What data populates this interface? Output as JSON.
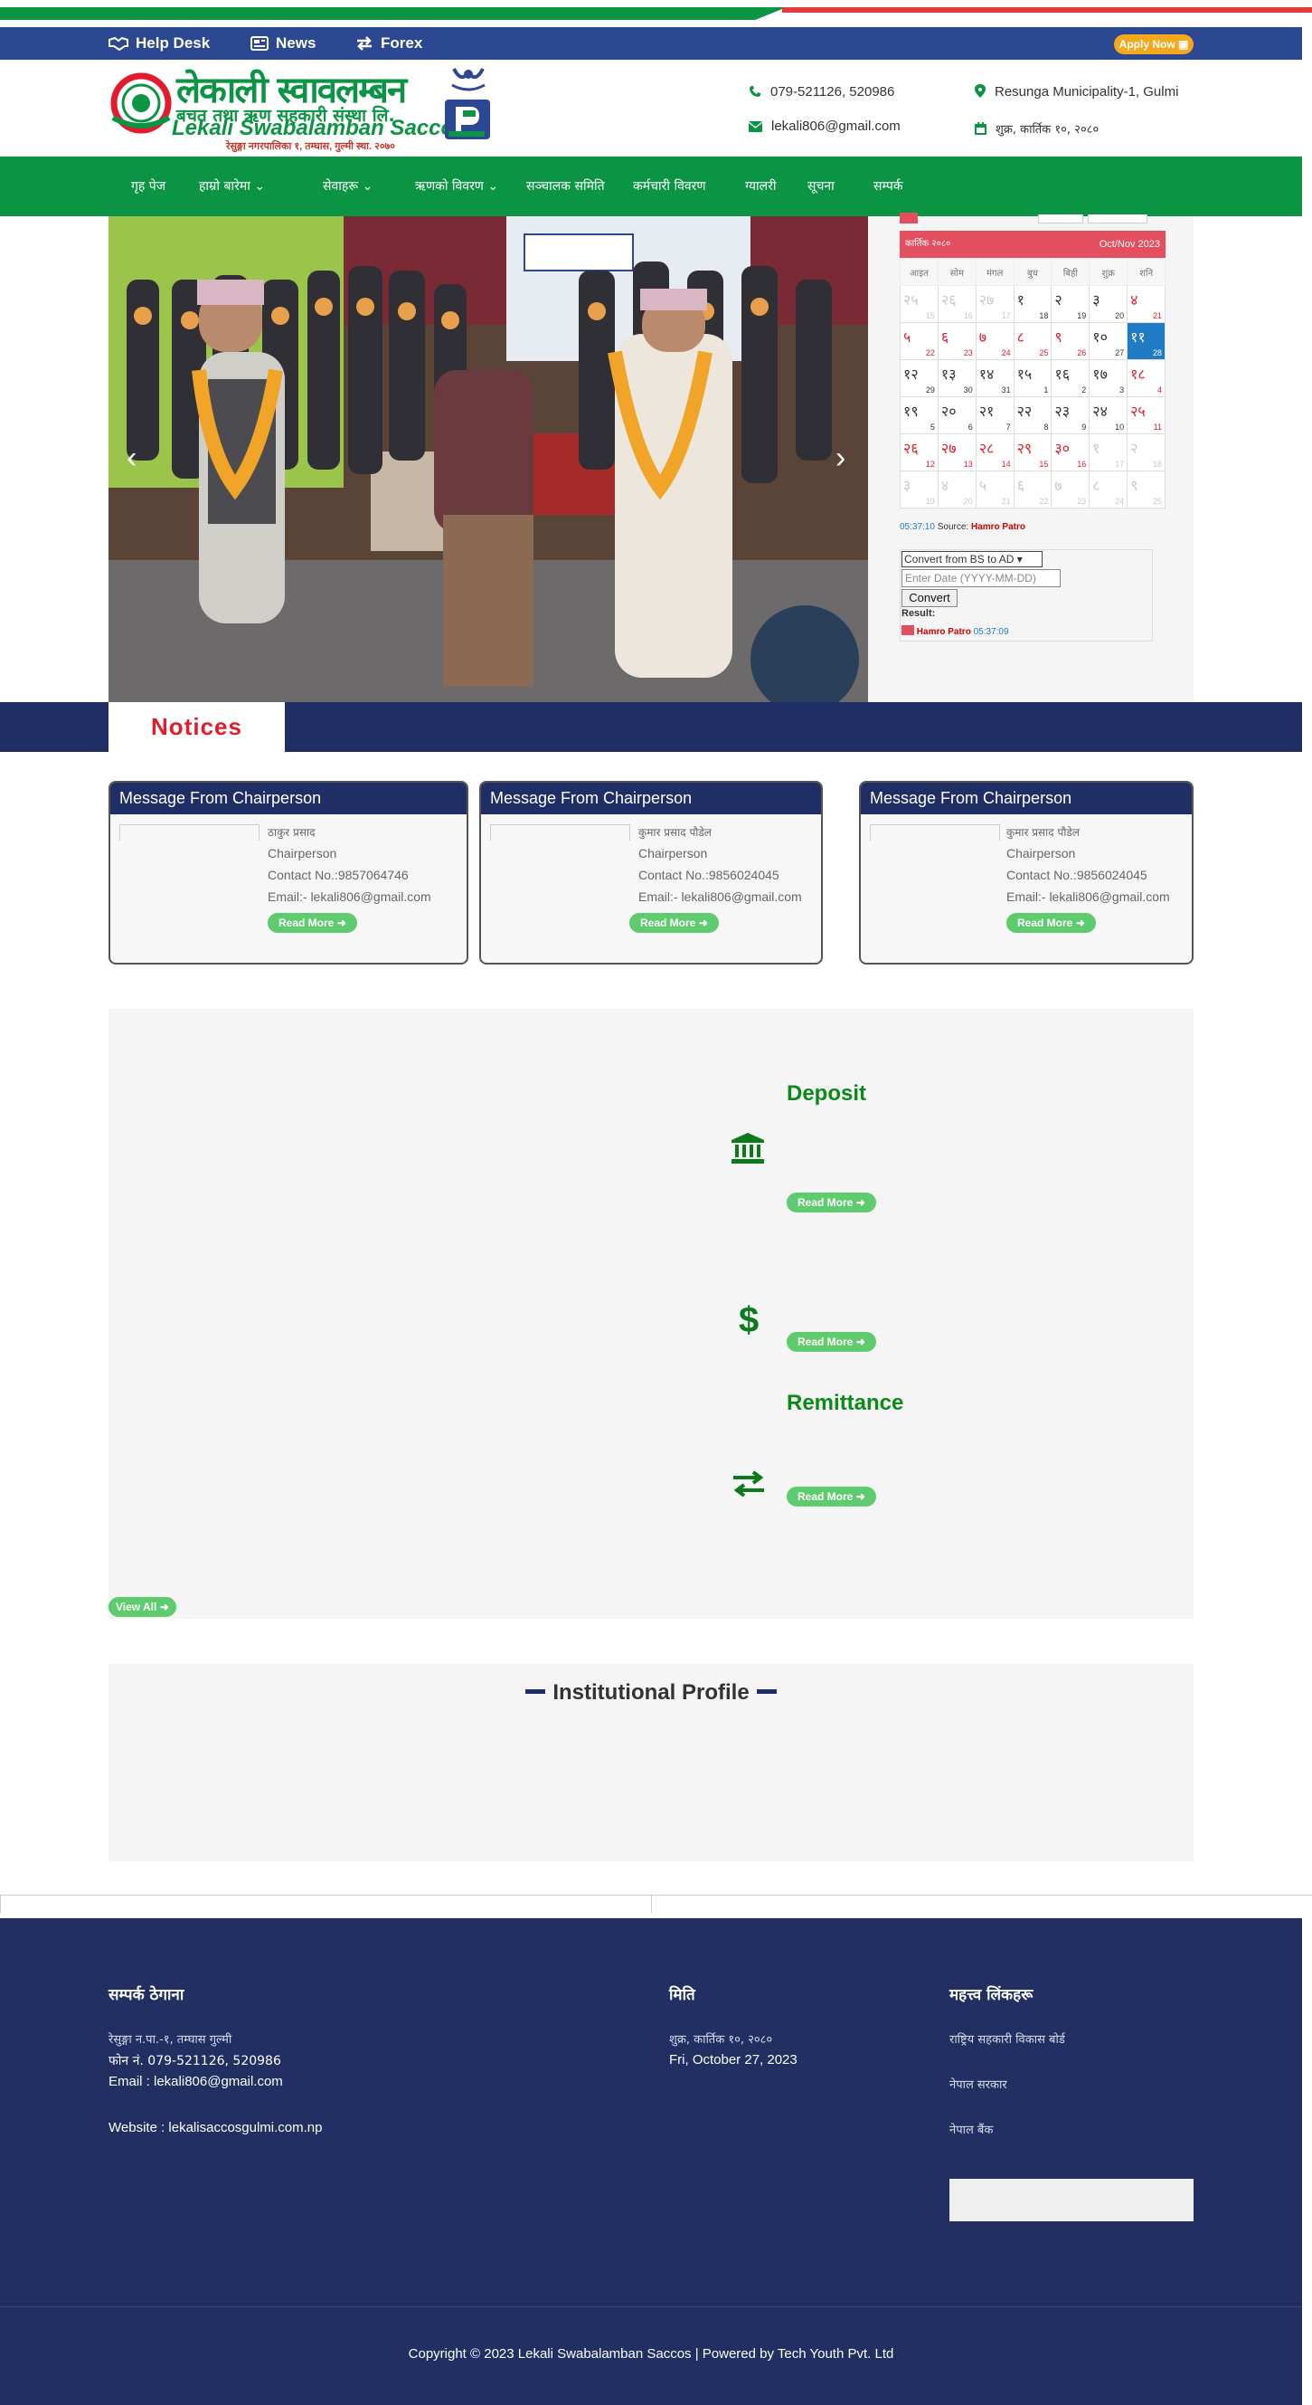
{
  "topbar": {
    "help_desk": "Help Desk",
    "news": "News",
    "forex": "Forex",
    "apply_now": "Apply Now"
  },
  "logo": {
    "nepali_name": "लेकाली स्वावलम्बन",
    "nepali_sub": "बचत तथा ऋण सहकारी संस्था लि.",
    "english_name": "Lekali Swabalamban Saccos",
    "address_line": "रेसुङ्गा नगरपालिका १, तम्घास, गुल्मी",
    "estd": "स्था. २०७०"
  },
  "header": {
    "phone": "079-521126, 520986",
    "email": "lekali806@gmail.com",
    "address": "Resunga Municipality-1, Gulmi",
    "date_np": "शुक्र, कार्तिक १०, २०८०"
  },
  "nav": {
    "items": [
      {
        "label": "गृह पेज",
        "dropdown": false
      },
      {
        "label": "हाम्रो बारेमा",
        "dropdown": true
      },
      {
        "label": "सेवाहरू",
        "dropdown": true
      },
      {
        "label": "ऋणको विवरण",
        "dropdown": true
      },
      {
        "label": "सञ्चालक समिति",
        "dropdown": false
      },
      {
        "label": "कर्मचारी विवरण",
        "dropdown": false
      },
      {
        "label": "ग्यालरी",
        "dropdown": false
      },
      {
        "label": "सूचना",
        "dropdown": false
      },
      {
        "label": "सम्पर्क",
        "dropdown": false
      }
    ]
  },
  "calendar": {
    "month_np": "कार्तिक २०८०",
    "month_en": "Oct/Nov 2023",
    "weekdays": [
      "आइत",
      "सोम",
      "मंगल",
      "बुध",
      "बिही",
      "शुक्र",
      "शनि"
    ],
    "weeks": [
      [
        {
          "np": "२५",
          "en": "15",
          "dim": true
        },
        {
          "np": "२६",
          "en": "16",
          "dim": true
        },
        {
          "np": "२७",
          "en": "17",
          "dim": true
        },
        {
          "np": "१",
          "en": "18"
        },
        {
          "np": "२",
          "en": "19"
        },
        {
          "np": "३",
          "en": "20"
        },
        {
          "np": "४",
          "en": "21",
          "red": true
        }
      ],
      [
        {
          "np": "५",
          "en": "22",
          "red": true
        },
        {
          "np": "६",
          "en": "23",
          "red": true
        },
        {
          "np": "७",
          "en": "24",
          "red": true
        },
        {
          "np": "८",
          "en": "25",
          "red": true
        },
        {
          "np": "९",
          "en": "26",
          "red": true
        },
        {
          "np": "१०",
          "en": "27"
        },
        {
          "np": "११",
          "en": "28",
          "today": true
        }
      ],
      [
        {
          "np": "१२",
          "en": "29"
        },
        {
          "np": "१३",
          "en": "30"
        },
        {
          "np": "१४",
          "en": "31"
        },
        {
          "np": "१५",
          "en": "1"
        },
        {
          "np": "१६",
          "en": "2"
        },
        {
          "np": "१७",
          "en": "3"
        },
        {
          "np": "१८",
          "en": "4",
          "red": true
        }
      ],
      [
        {
          "np": "१९",
          "en": "5"
        },
        {
          "np": "२०",
          "en": "6"
        },
        {
          "np": "२१",
          "en": "7"
        },
        {
          "np": "२२",
          "en": "8"
        },
        {
          "np": "२३",
          "en": "9"
        },
        {
          "np": "२४",
          "en": "10"
        },
        {
          "np": "२५",
          "en": "11",
          "red": true
        }
      ],
      [
        {
          "np": "२६",
          "en": "12",
          "red": true
        },
        {
          "np": "२७",
          "en": "13",
          "red": true
        },
        {
          "np": "२८",
          "en": "14",
          "red": true
        },
        {
          "np": "२९",
          "en": "15",
          "red": true
        },
        {
          "np": "३०",
          "en": "16",
          "red": true
        },
        {
          "np": "१",
          "en": "17",
          "dim": true
        },
        {
          "np": "२",
          "en": "18",
          "dim": true
        }
      ],
      [
        {
          "np": "३",
          "en": "19",
          "dim": true
        },
        {
          "np": "४",
          "en": "20",
          "dim": true
        },
        {
          "np": "५",
          "en": "21",
          "dim": true
        },
        {
          "np": "६",
          "en": "22",
          "dim": true
        },
        {
          "np": "७",
          "en": "23",
          "dim": true
        },
        {
          "np": "८",
          "en": "24",
          "dim": true
        },
        {
          "np": "९",
          "en": "25",
          "dim": true
        }
      ]
    ],
    "time": "05:37:10",
    "source_label": "Source:",
    "source": "Hamro Patro",
    "converter_option": "Convert from BS to AD",
    "converter_placeholder": "Enter Date (YYYY-MM-DD)",
    "convert_button": "Convert",
    "result_label": "Result:",
    "footer_source": "Hamro Patro",
    "footer_time": "05:37:09"
  },
  "notices": {
    "title": "Notices"
  },
  "messages": [
    {
      "heading": "Message From Chairperson",
      "name": "ठाकुर प्रसाद",
      "role": "Chairperson",
      "contact": "Contact No.:9857064746",
      "email": "Email:- lekali806@gmail.com",
      "read_more": "Read More"
    },
    {
      "heading": "Message From Chairperson",
      "name": "कुमार प्रसाद पौडेल",
      "role": "Chairperson",
      "contact": "Contact No.:9856024045",
      "email": "Email:- lekali806@gmail.com",
      "read_more": "Read More"
    },
    {
      "heading": "Message From Chairperson",
      "name": "कुमार प्रसाद पौडेल",
      "role": "Chairperson",
      "contact": "Contact No.:9856024045",
      "email": "Email:- lekali806@gmail.com",
      "read_more": "Read More"
    }
  ],
  "services": {
    "items": [
      {
        "title": "Deposit",
        "icon": "bank-icon",
        "read_more": "Read More"
      },
      {
        "title": "",
        "icon": "dollar-icon",
        "read_more": "Read More"
      },
      {
        "title": "Remittance",
        "icon": "exchange-icon",
        "read_more": "Read More"
      }
    ],
    "view_all": "View All"
  },
  "profile": {
    "title": "Institutional Profile"
  },
  "footer": {
    "col1_heading": "सम्पर्क ठेगाना",
    "col1_address": "रेसुङ्गा न.पा.-१, तम्घास गुल्मी",
    "col1_phone": "फोन नं. 079-521126, 520986",
    "col1_email": "Email : lekali806@gmail.com",
    "col1_website": "Website : lekalisaccosgulmi.com.np",
    "col2_heading": "मिति",
    "col2_date_np": "शुक्र, कार्तिक १०, २०८०",
    "col2_date_en": "Fri, October 27, 2023",
    "col3_heading": "महत्त्व लिंकहरू",
    "col3_links": [
      "राष्ट्रिय सहकारी विकास बोर्ड",
      "नेपाल सरकार",
      "नेपाल बैंक"
    ],
    "copyright": "Copyright © 2023 Lekali Swabalamban Saccos | Powered by Tech Youth Pvt. Ltd"
  },
  "colors": {
    "green": "#0b9444",
    "navy": "#1f2f66",
    "topbar": "#2d4892",
    "red": "#e21c2c",
    "accent": "#5ecb6e",
    "apply": "#f4a81c"
  }
}
